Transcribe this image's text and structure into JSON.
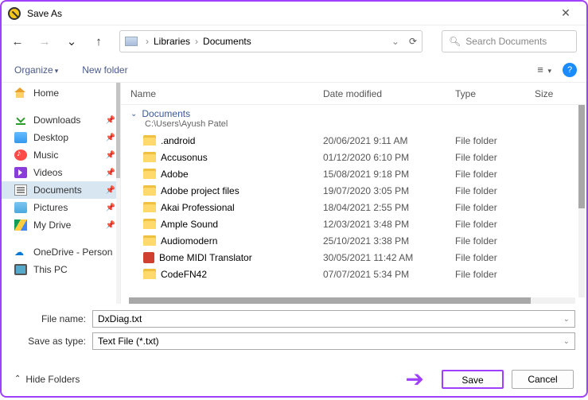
{
  "title": "Save As",
  "nav": {
    "crumb1": "Libraries",
    "crumb2": "Documents",
    "search_placeholder": "Search Documents"
  },
  "toolbar": {
    "organize": "Organize",
    "new_folder": "New folder"
  },
  "sidebar": {
    "home": "Home",
    "items": [
      {
        "label": "Downloads"
      },
      {
        "label": "Desktop"
      },
      {
        "label": "Music"
      },
      {
        "label": "Videos"
      },
      {
        "label": "Documents"
      },
      {
        "label": "Pictures"
      },
      {
        "label": "My Drive"
      }
    ],
    "onedrive": "OneDrive - Person",
    "thispc": "This PC"
  },
  "columns": {
    "name": "Name",
    "date": "Date modified",
    "type": "Type",
    "size": "Size"
  },
  "group": {
    "title": "Documents",
    "subtitle": "C:\\Users\\Ayush Patel"
  },
  "folder_type": "File folder",
  "files": [
    {
      "name": ".android",
      "date": "20/06/2021 9:11 AM",
      "icon": "folder"
    },
    {
      "name": "Accusonus",
      "date": "01/12/2020 6:10 PM",
      "icon": "folder"
    },
    {
      "name": "Adobe",
      "date": "15/08/2021 9:18 PM",
      "icon": "folder"
    },
    {
      "name": "Adobe project files",
      "date": "19/07/2020 3:05 PM",
      "icon": "folder"
    },
    {
      "name": "Akai Professional",
      "date": "18/04/2021 2:55 PM",
      "icon": "folder"
    },
    {
      "name": "Ample Sound",
      "date": "12/03/2021 3:48 PM",
      "icon": "folder"
    },
    {
      "name": "Audiomodern",
      "date": "25/10/2021 3:38 PM",
      "icon": "folder"
    },
    {
      "name": "Bome MIDI Translator",
      "date": "30/05/2021 11:42 AM",
      "icon": "app"
    },
    {
      "name": "CodeFN42",
      "date": "07/07/2021 5:34 PM",
      "icon": "folder"
    }
  ],
  "form": {
    "name_label": "File name:",
    "name_value": "DxDiag.txt",
    "type_label": "Save as type:",
    "type_value": "Text File (*.txt)"
  },
  "bottom": {
    "hide": "Hide Folders",
    "save": "Save",
    "cancel": "Cancel"
  }
}
